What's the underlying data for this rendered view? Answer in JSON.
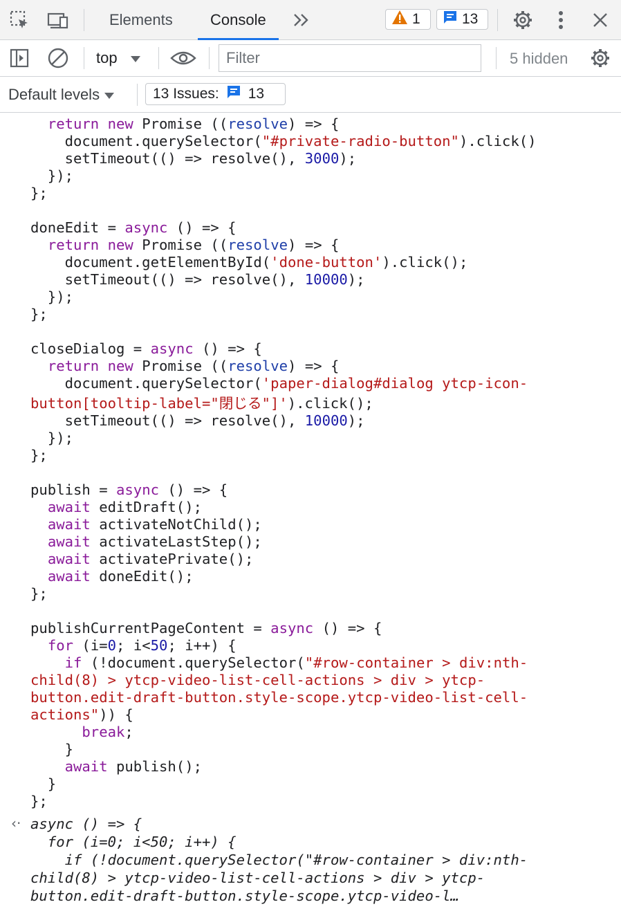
{
  "tabs": [
    {
      "label": "Elements",
      "active": false
    },
    {
      "label": "Console",
      "active": true
    }
  ],
  "header_badges": {
    "warnings": "1",
    "messages": "13"
  },
  "console_toolbar": {
    "context": "top",
    "filter_placeholder": "Filter",
    "hidden_count": "5 hidden"
  },
  "levels_toolbar": {
    "levels": "Default levels",
    "issues_label": "13 Issues:",
    "issues_count": "13"
  },
  "colors": {
    "keyword": "#8a1b9a",
    "string": "#b51a1a",
    "number": "#1a1aa6",
    "variable": "#1f3fa8",
    "accent": "#1a73e8",
    "warning": "#e37400"
  },
  "code_lines": [
    [
      {
        "t": "  "
      },
      {
        "t": "return",
        "c": "k"
      },
      {
        "t": " "
      },
      {
        "t": "new",
        "c": "k"
      },
      {
        "t": " Promise (("
      },
      {
        "t": "resolve",
        "c": "v"
      },
      {
        "t": ") => {"
      }
    ],
    [
      {
        "t": "    document.querySelector("
      },
      {
        "t": "\"#private-radio-button\"",
        "c": "s"
      },
      {
        "t": ").click()"
      }
    ],
    [
      {
        "t": "    setTimeout(() => resolve(), "
      },
      {
        "t": "3000",
        "c": "n"
      },
      {
        "t": ");"
      }
    ],
    [
      {
        "t": "  });"
      }
    ],
    [
      {
        "t": "};"
      }
    ],
    [
      {
        "t": ""
      }
    ],
    [
      {
        "t": "doneEdit = "
      },
      {
        "t": "async",
        "c": "k"
      },
      {
        "t": " () => {"
      }
    ],
    [
      {
        "t": "  "
      },
      {
        "t": "return",
        "c": "k"
      },
      {
        "t": " "
      },
      {
        "t": "new",
        "c": "k"
      },
      {
        "t": " Promise (("
      },
      {
        "t": "resolve",
        "c": "v"
      },
      {
        "t": ") => {"
      }
    ],
    [
      {
        "t": "    document.getElementById("
      },
      {
        "t": "'done-button'",
        "c": "s"
      },
      {
        "t": ").click();"
      }
    ],
    [
      {
        "t": "    setTimeout(() => resolve(), "
      },
      {
        "t": "10000",
        "c": "n"
      },
      {
        "t": ");"
      }
    ],
    [
      {
        "t": "  });"
      }
    ],
    [
      {
        "t": "};"
      }
    ],
    [
      {
        "t": ""
      }
    ],
    [
      {
        "t": "closeDialog = "
      },
      {
        "t": "async",
        "c": "k"
      },
      {
        "t": " () => {"
      }
    ],
    [
      {
        "t": "  "
      },
      {
        "t": "return",
        "c": "k"
      },
      {
        "t": " "
      },
      {
        "t": "new",
        "c": "k"
      },
      {
        "t": " Promise (("
      },
      {
        "t": "resolve",
        "c": "v"
      },
      {
        "t": ") => {"
      }
    ],
    [
      {
        "t": "    document.querySelector("
      },
      {
        "t": "'paper-dialog#dialog ytcp-icon-",
        "c": "s"
      }
    ],
    [
      {
        "t": "button[tooltip-label=\"閉じる\"]'",
        "c": "s"
      },
      {
        "t": ").click();"
      }
    ],
    [
      {
        "t": "    setTimeout(() => resolve(), "
      },
      {
        "t": "10000",
        "c": "n"
      },
      {
        "t": ");"
      }
    ],
    [
      {
        "t": "  });"
      }
    ],
    [
      {
        "t": "};"
      }
    ],
    [
      {
        "t": ""
      }
    ],
    [
      {
        "t": "publish = "
      },
      {
        "t": "async",
        "c": "k"
      },
      {
        "t": " () => {"
      }
    ],
    [
      {
        "t": "  "
      },
      {
        "t": "await",
        "c": "k"
      },
      {
        "t": " editDraft();"
      }
    ],
    [
      {
        "t": "  "
      },
      {
        "t": "await",
        "c": "k"
      },
      {
        "t": " activateNotChild();"
      }
    ],
    [
      {
        "t": "  "
      },
      {
        "t": "await",
        "c": "k"
      },
      {
        "t": " activateLastStep();"
      }
    ],
    [
      {
        "t": "  "
      },
      {
        "t": "await",
        "c": "k"
      },
      {
        "t": " activatePrivate();"
      }
    ],
    [
      {
        "t": "  "
      },
      {
        "t": "await",
        "c": "k"
      },
      {
        "t": " doneEdit();"
      }
    ],
    [
      {
        "t": "};"
      }
    ],
    [
      {
        "t": ""
      }
    ],
    [
      {
        "t": "publishCurrentPageContent = "
      },
      {
        "t": "async",
        "c": "k"
      },
      {
        "t": " () => {"
      }
    ],
    [
      {
        "t": "  "
      },
      {
        "t": "for",
        "c": "k"
      },
      {
        "t": " (i="
      },
      {
        "t": "0",
        "c": "n"
      },
      {
        "t": "; i<"
      },
      {
        "t": "50",
        "c": "n"
      },
      {
        "t": "; i++) {"
      }
    ],
    [
      {
        "t": "    "
      },
      {
        "t": "if",
        "c": "k"
      },
      {
        "t": " (!document.querySelector("
      },
      {
        "t": "\"#row-container > div:nth-",
        "c": "s"
      }
    ],
    [
      {
        "t": "child(8) > ytcp-video-list-cell-actions > div > ytcp-",
        "c": "s"
      }
    ],
    [
      {
        "t": "button.edit-draft-button.style-scope.ytcp-video-list-cell-",
        "c": "s"
      }
    ],
    [
      {
        "t": "actions\"",
        "c": "s"
      },
      {
        "t": ")) {"
      }
    ],
    [
      {
        "t": "      "
      },
      {
        "t": "break",
        "c": "k"
      },
      {
        "t": ";"
      }
    ],
    [
      {
        "t": "    }"
      }
    ],
    [
      {
        "t": "    "
      },
      {
        "t": "await",
        "c": "k"
      },
      {
        "t": " publish();"
      }
    ],
    [
      {
        "t": "  }"
      }
    ],
    [
      {
        "t": "};"
      }
    ]
  ],
  "result_lines": [
    [
      {
        "t": "async () => {"
      }
    ],
    [
      {
        "t": "  for (i=0; i<50; i++) {"
      }
    ],
    [
      {
        "t": "    if (!document.querySelector(\"#row-container > div:nth-"
      }
    ],
    [
      {
        "t": "child(8) > ytcp-video-list-cell-actions > div > ytcp-"
      }
    ],
    [
      {
        "t": "button.edit-draft-button.style-scope.ytcp-video-l…"
      }
    ]
  ]
}
